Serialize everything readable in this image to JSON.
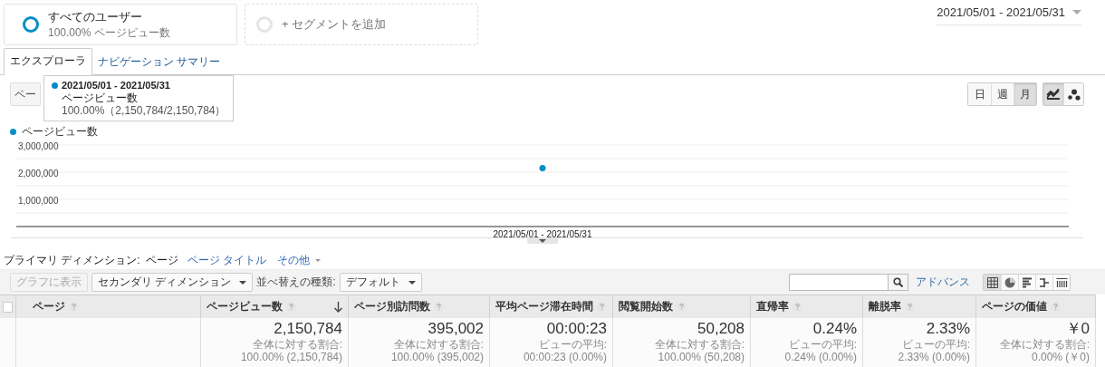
{
  "segments": [
    {
      "kind": "active",
      "name": "すべてのユーザー",
      "subtitle": "100.00% ページビュー数"
    },
    {
      "kind": "add",
      "name": "+ セグメントを追加"
    }
  ],
  "date_range": "2021/05/01 - 2021/05/31",
  "tabs": [
    {
      "label": "エクスプローラ",
      "selected": true
    },
    {
      "label": "ナビゲーション サマリー",
      "selected": false
    }
  ],
  "metric_select": "ペー",
  "tooltip": {
    "date": "2021/05/01 - 2021/05/31",
    "metric": "ページビュー数",
    "value": "100.00%（2,150,784/2,150,784）"
  },
  "period_buttons": [
    {
      "label": "日",
      "selected": false
    },
    {
      "label": "週",
      "selected": false
    },
    {
      "label": "月",
      "selected": true
    }
  ],
  "chart_types": [
    {
      "kind": "line",
      "selected": true
    },
    {
      "kind": "motion",
      "selected": false
    }
  ],
  "chart": {
    "chart_data": {
      "type": "line",
      "categories": [
        "2021/05/01 - 2021/05/31"
      ],
      "series": [
        {
          "name": "ページビュー数",
          "color": "#058dc7",
          "marker": "circle",
          "values": [
            2150784
          ]
        }
      ],
      "ylim": [
        0,
        3000000
      ],
      "yticks": [
        {
          "value": 1000000,
          "label": "1,000,000"
        },
        {
          "value": 2000000,
          "label": "2,000,000"
        },
        {
          "value": 3000000,
          "label": "3,000,000"
        }
      ]
    }
  },
  "primary_dimension": {
    "label": "プライマリ ディメンション:",
    "options": [
      {
        "label": "ページ",
        "selected": true
      },
      {
        "label": "ページ タイトル",
        "selected": false
      }
    ],
    "more": "その他"
  },
  "toolbar": {
    "plot_button": {
      "label": "グラフに表示",
      "disabled": true
    },
    "secondary": "セカンダリ ディメンション",
    "sort_label": "並べ替えの種類:",
    "sort_value": "デフォルト",
    "advanced": "アドバンス",
    "views": [
      {
        "kind": "table",
        "selected": true
      },
      {
        "kind": "pie",
        "selected": false
      },
      {
        "kind": "bar",
        "selected": false
      },
      {
        "kind": "compare",
        "selected": false
      },
      {
        "kind": "pivot",
        "selected": false
      }
    ]
  },
  "table": {
    "select_all_checked": false,
    "columns": [
      {
        "label": "ページ",
        "sorted": false
      },
      {
        "label": "ページビュー数",
        "sorted": true
      },
      {
        "label": "ページ別訪問数",
        "sorted": false
      },
      {
        "label": "平均ページ滞在時間",
        "sorted": false
      },
      {
        "label": "閲覧開始数",
        "sorted": false
      },
      {
        "label": "直帰率",
        "sorted": false
      },
      {
        "label": "離脱率",
        "sorted": false
      },
      {
        "label": "ページの価値",
        "sorted": false
      }
    ],
    "totals": [
      {
        "value": "2,150,784",
        "sub": "全体に対する割合: 100.00% (2,150,784)"
      },
      {
        "value": "395,002",
        "sub": "全体に対する割合: 100.00% (395,002)"
      },
      {
        "value": "00:00:23",
        "sub": "ビューの平均: 00:00:23 (0.00%)"
      },
      {
        "value": "50,208",
        "sub": "全体に対する割合: 100.00% (50,208)"
      },
      {
        "value": "0.24%",
        "sub": "ビューの平均: 0.24% (0.00%)"
      },
      {
        "value": "2.33%",
        "sub": "ビューの平均: 2.33% (0.00%)"
      },
      {
        "value": "￥0",
        "sub": "全体に対する割合: 0.00% (￥0)"
      }
    ]
  }
}
